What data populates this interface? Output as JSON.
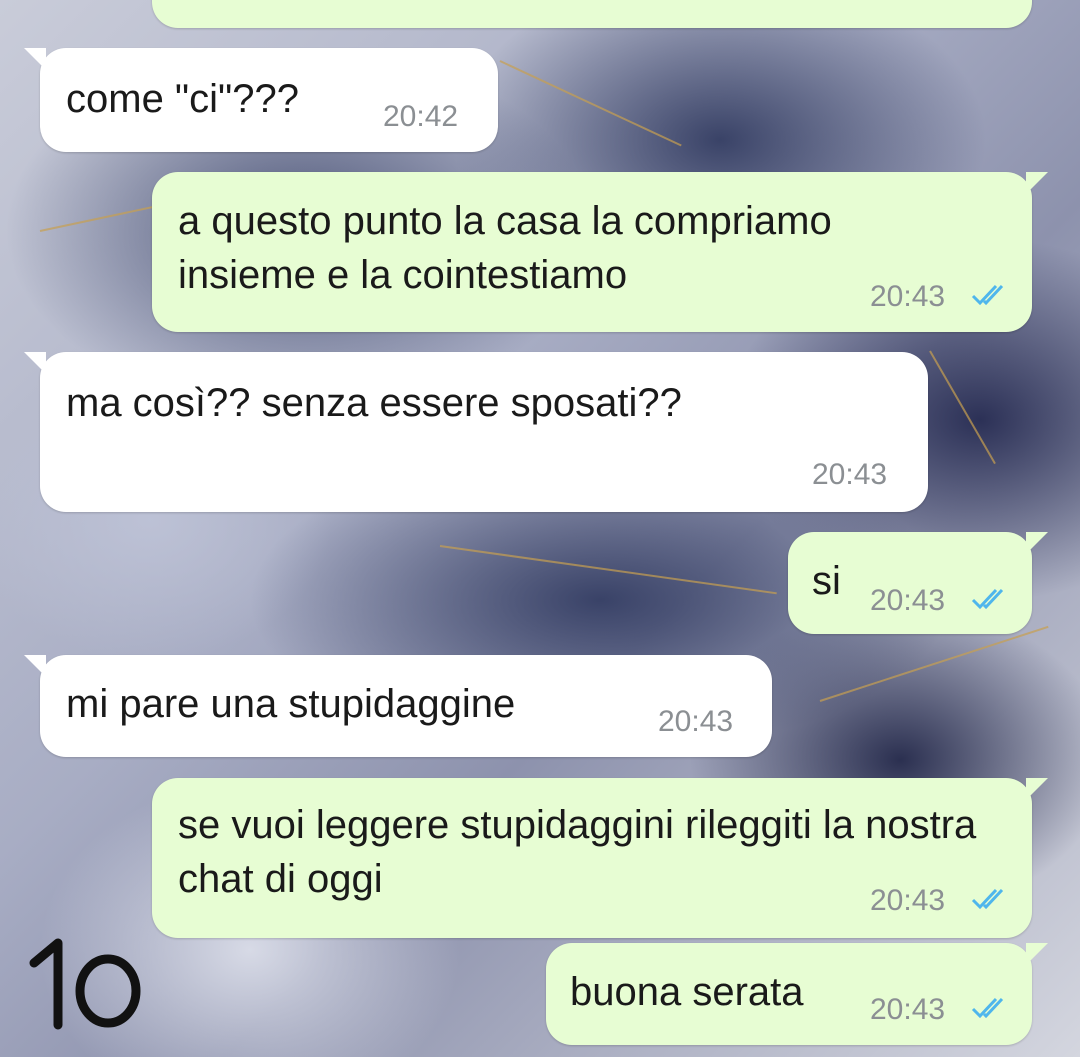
{
  "colors": {
    "incoming_bubble": "#ffffff",
    "outgoing_bubble": "#e7fdd3",
    "timestamp": "#8b8f93",
    "read_ticks": "#4fb6ec"
  },
  "messages": [
    {
      "direction": "incoming",
      "text": "come \"ci\"???",
      "time": "20:42"
    },
    {
      "direction": "outgoing",
      "text": "a questo punto la casa la compriamo insieme e la cointestiamo",
      "time": "20:43",
      "status_icon": "double-check-read-icon"
    },
    {
      "direction": "incoming",
      "text": "ma così?? senza essere sposati??",
      "time": "20:43"
    },
    {
      "direction": "outgoing",
      "text": "si",
      "time": "20:43",
      "status_icon": "double-check-read-icon"
    },
    {
      "direction": "incoming",
      "text": "mi pare una stupidaggine",
      "time": "20:43"
    },
    {
      "direction": "outgoing",
      "text": "se vuoi leggere stupidaggini rileggiti la nostra chat di oggi",
      "time": "20:43",
      "status_icon": "double-check-read-icon"
    },
    {
      "direction": "outgoing",
      "text": "buona serata",
      "time": "20:43",
      "status_icon": "double-check-read-icon"
    }
  ],
  "annotation": {
    "text": "10"
  }
}
